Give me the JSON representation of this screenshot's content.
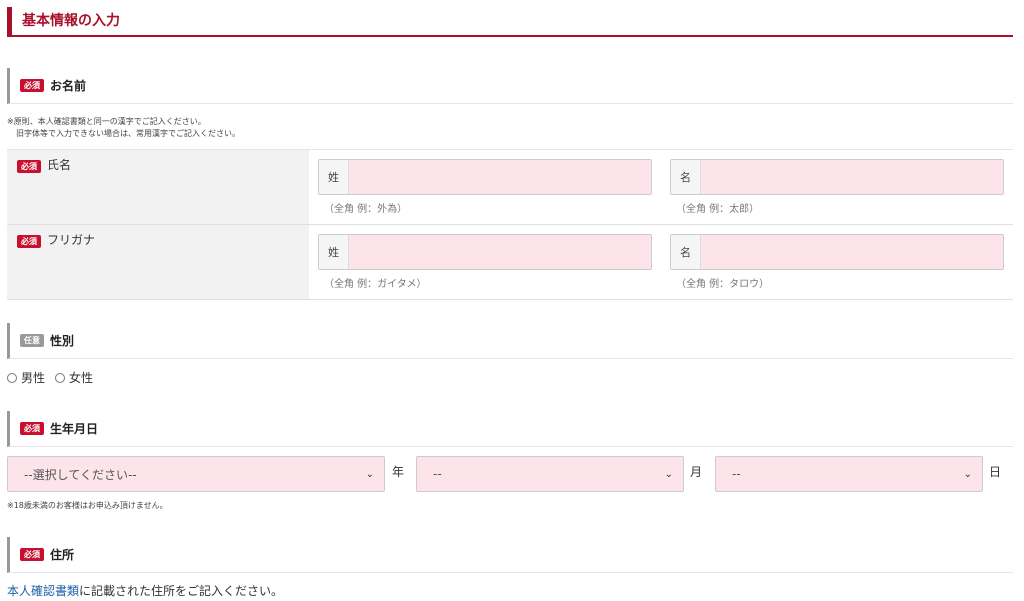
{
  "header": {
    "title": "基本情報の入力"
  },
  "badges": {
    "required": "必須",
    "optional": "任意"
  },
  "name_section": {
    "title": "お名前",
    "note_line1": "※原則、本人確認書類と同一の漢字でご記入ください。",
    "note_line2": "旧字体等で入力できない場合は、常用漢字でご記入ください。",
    "rows": [
      {
        "label": "氏名",
        "last": {
          "prefix": "姓",
          "value": "",
          "hint": "（全角 例：外為）"
        },
        "first": {
          "prefix": "名",
          "value": "",
          "hint": "（全角 例：太郎）"
        }
      },
      {
        "label": "フリガナ",
        "last": {
          "prefix": "姓",
          "value": "",
          "hint": "（全角 例：ガイタメ）"
        },
        "first": {
          "prefix": "名",
          "value": "",
          "hint": "（全角 例：タロウ）"
        }
      }
    ]
  },
  "gender_section": {
    "title": "性別",
    "options": [
      "男性",
      "女性"
    ]
  },
  "birth_section": {
    "title": "生年月日",
    "year": {
      "selected": "--選択してください--",
      "unit": "年"
    },
    "month": {
      "selected": "--",
      "unit": "月"
    },
    "day": {
      "selected": "--",
      "unit": "日"
    },
    "note": "※18歳未満のお客様はお申込み頂けません。"
  },
  "address_section": {
    "title": "住所",
    "link_text": "本人確認書類",
    "line_rest": "に記載された住所をご記入ください。"
  },
  "colors": {
    "accent": "#a8102b",
    "required_badge": "#c8102e",
    "input_bg": "#fce4ea",
    "link": "#1a5fa8"
  }
}
